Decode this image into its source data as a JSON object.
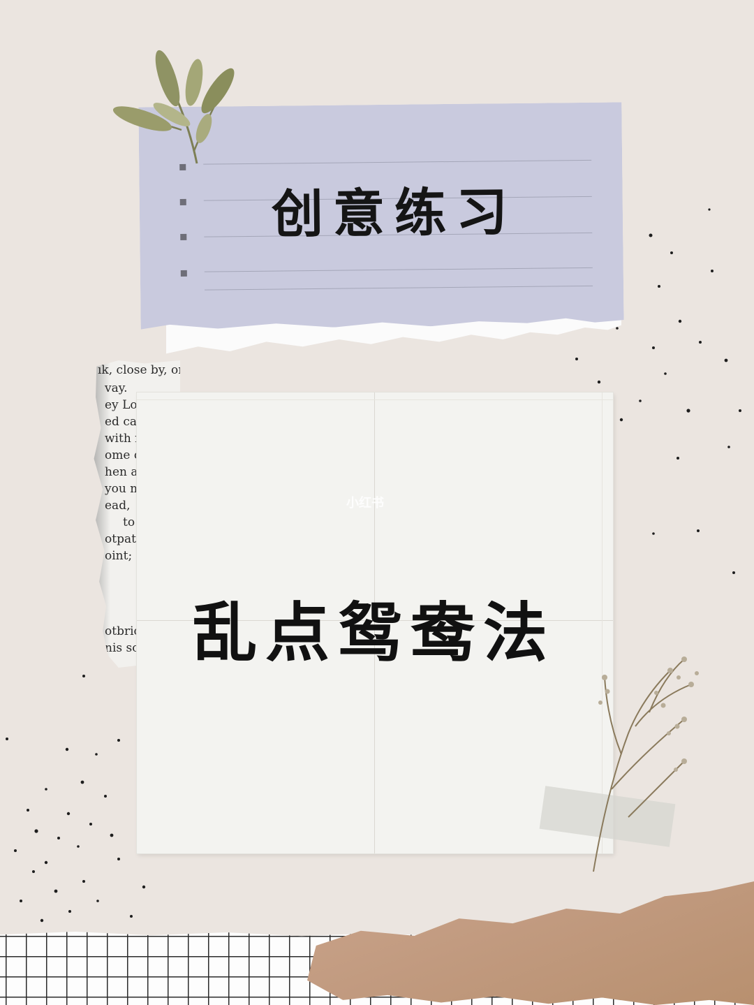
{
  "title_card": {
    "text": "创意练习"
  },
  "main_card": {
    "text": "乱点鸳鸯法",
    "watermark": "小红书"
  },
  "newspaper": {
    "lines": [
      "ık, close by, or",
      "vay.",
      "ey Lo",
      "ed car p",
      "with ma",
      "ome of",
      "hen a",
      "you m",
      "ead,",
      "to",
      "otpath",
      "oint; d",
      "otbric",
      "nis so"
    ]
  },
  "colors": {
    "background": "#ebe5e0",
    "title_card": "#c9cade",
    "main_paper": "#f3f3f0",
    "kraft_paper": "#c19a7f",
    "leaf": "#8f9364",
    "text": "#111111"
  }
}
